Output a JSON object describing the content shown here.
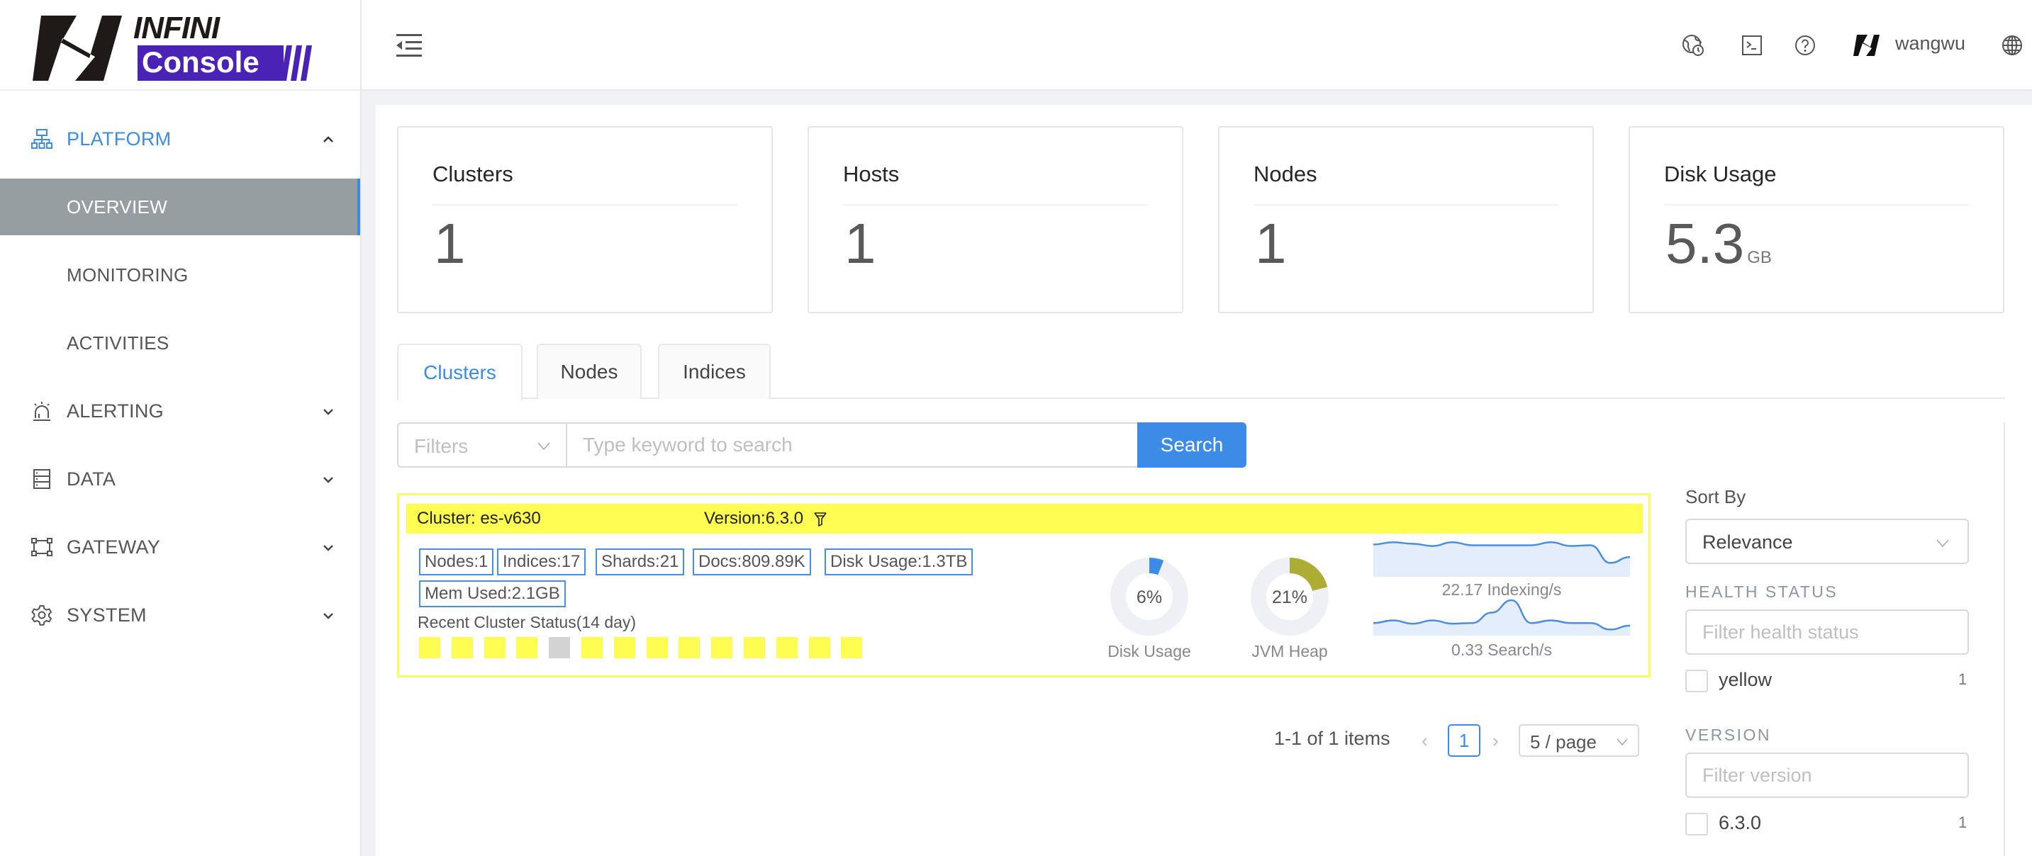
{
  "app": {
    "logo_top": "INFINI",
    "logo_bottom": "Console",
    "brand_color": "#4a22b6"
  },
  "sidebar": {
    "groups": [
      {
        "label": "PLATFORM",
        "icon": "cluster-icon",
        "expanded": true,
        "items": [
          {
            "label": "OVERVIEW",
            "active": true
          },
          {
            "label": "MONITORING",
            "active": false
          },
          {
            "label": "ACTIVITIES",
            "active": false
          }
        ]
      },
      {
        "label": "ALERTING",
        "icon": "alarm-icon",
        "expanded": false
      },
      {
        "label": "DATA",
        "icon": "database-icon",
        "expanded": false
      },
      {
        "label": "GATEWAY",
        "icon": "gateway-icon",
        "expanded": false
      },
      {
        "label": "SYSTEM",
        "icon": "gear-icon",
        "expanded": false
      }
    ]
  },
  "header": {
    "icons": [
      "menu-fold-icon",
      "global-clock-icon",
      "terminal-icon",
      "help-icon",
      "user-avatar-icon",
      "language-globe-icon"
    ],
    "username": "wangwu"
  },
  "stats": [
    {
      "title": "Clusters",
      "value": "1",
      "unit": ""
    },
    {
      "title": "Hosts",
      "value": "1",
      "unit": ""
    },
    {
      "title": "Nodes",
      "value": "1",
      "unit": ""
    },
    {
      "title": "Disk Usage",
      "value": "5.3",
      "unit": "GB"
    }
  ],
  "tabs": [
    {
      "label": "Clusters",
      "active": true
    },
    {
      "label": "Nodes",
      "active": false
    },
    {
      "label": "Indices",
      "active": false
    }
  ],
  "search": {
    "filters_placeholder": "Filters",
    "input_placeholder": "Type keyword to search",
    "input_value": "",
    "button_label": "Search"
  },
  "clusters": [
    {
      "name_label": "Cluster: es-v630",
      "version_label": "Version:6.3.0",
      "health_color": "#fffc52",
      "metrics": [
        "Nodes:1",
        "Indices:17",
        "Shards:21",
        "Docs:809.89K",
        "Disk Usage:1.3TB",
        "Mem Used:2.1GB"
      ],
      "recent_status_label": "Recent Cluster Status(14 day)",
      "recent_status": [
        "yellow",
        "yellow",
        "yellow",
        "yellow",
        "gray",
        "yellow",
        "yellow",
        "yellow",
        "yellow",
        "yellow",
        "yellow",
        "yellow",
        "yellow",
        "yellow"
      ],
      "status_colors": {
        "yellow": "#fffc52",
        "gray": "#d3d3d3"
      },
      "gauges": [
        {
          "label": "Disk Usage",
          "percent": 6,
          "text": "6%",
          "color": "#3c8ce7"
        },
        {
          "label": "JVM Heap",
          "percent": 21,
          "text": "21%",
          "color": "#adad35"
        }
      ],
      "sparklines": [
        {
          "label": "22.17 Indexing/s",
          "values": [
            0.8,
            0.86,
            0.82,
            0.76,
            0.86,
            0.78,
            0.78,
            0.78,
            0.78,
            0.86,
            0.76,
            0.78,
            0.3,
            0.46
          ]
        },
        {
          "label": "0.33 Search/s",
          "values": [
            0.3,
            0.38,
            0.28,
            0.38,
            0.28,
            0.3,
            0.62,
            1.0,
            0.3,
            0.38,
            0.3,
            0.3,
            0.1,
            0.22
          ]
        }
      ]
    }
  ],
  "pagination": {
    "total_label": "1-1 of 1 items",
    "current_page": "1",
    "page_size_label": "5 / page"
  },
  "filter_panel": {
    "sort_title": "Sort By",
    "sort_value": "Relevance",
    "health_title": "HEALTH STATUS",
    "health_placeholder": "Filter health status",
    "health_options": [
      {
        "label": "yellow",
        "count": "1",
        "checked": false
      }
    ],
    "version_title": "VERSION",
    "version_placeholder": "Filter version",
    "version_options": [
      {
        "label": "6.3.0",
        "count": "1",
        "checked": false
      }
    ]
  }
}
